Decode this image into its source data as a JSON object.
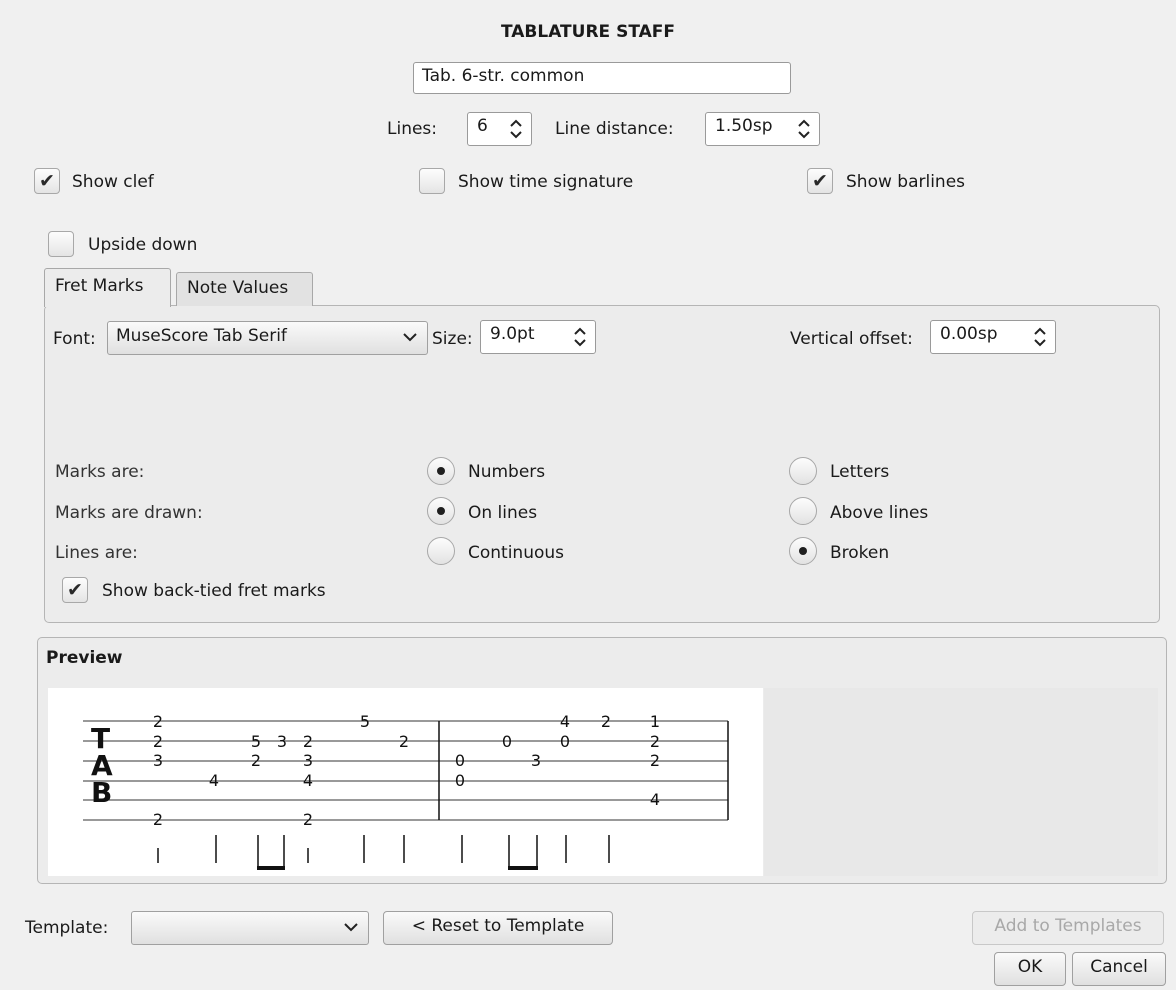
{
  "dialog": {
    "title": "TABLATURE STAFF",
    "staff_name": "Tab. 6-str. common",
    "lines_label": "Lines:",
    "lines_value": "6",
    "line_distance_label": "Line distance:",
    "line_distance_value": "1.50sp",
    "show_clef": {
      "label": "Show clef",
      "checked": true
    },
    "show_time_signature": {
      "label": "Show time signature",
      "checked": false
    },
    "show_barlines": {
      "label": "Show barlines",
      "checked": true
    },
    "upside_down": {
      "label": "Upside down",
      "checked": false
    }
  },
  "tabs": [
    {
      "label": "Fret Marks",
      "active": true
    },
    {
      "label": "Note Values",
      "active": false
    }
  ],
  "fret_marks": {
    "font_label": "Font:",
    "font_value": "MuseScore Tab Serif",
    "size_label": "Size:",
    "size_value": "9.0pt",
    "vertical_offset_label": "Vertical offset:",
    "vertical_offset_value": "0.00sp",
    "marks_are_label": "Marks are:",
    "marks_are_opt1": "Numbers",
    "marks_are_opt2": "Letters",
    "marks_are_selected": "Numbers",
    "marks_drawn_label": "Marks are drawn:",
    "marks_drawn_opt1": "On lines",
    "marks_drawn_opt2": "Above lines",
    "marks_drawn_selected": "On lines",
    "lines_are_label": "Lines are:",
    "lines_are_opt1": "Continuous",
    "lines_are_opt2": "Broken",
    "lines_are_selected": "Broken",
    "show_back_tied": {
      "label": "Show back-tied fret marks",
      "checked": true
    }
  },
  "preview": {
    "title": "Preview",
    "clef": [
      "T",
      "A",
      "B"
    ],
    "fret_numbers": [
      "2",
      "2",
      "3",
      "4",
      "5",
      "2",
      "3",
      "2",
      "3",
      "4",
      "2",
      "5",
      "2",
      "0",
      "0",
      "0",
      "3",
      "4",
      "0",
      "2",
      "1",
      "2",
      "2",
      "4"
    ]
  },
  "footer": {
    "template_label": "Template:",
    "template_value": "",
    "reset_button": "< Reset to Template",
    "add_button": "Add to Templates",
    "ok_button": "OK",
    "cancel_button": "Cancel"
  }
}
